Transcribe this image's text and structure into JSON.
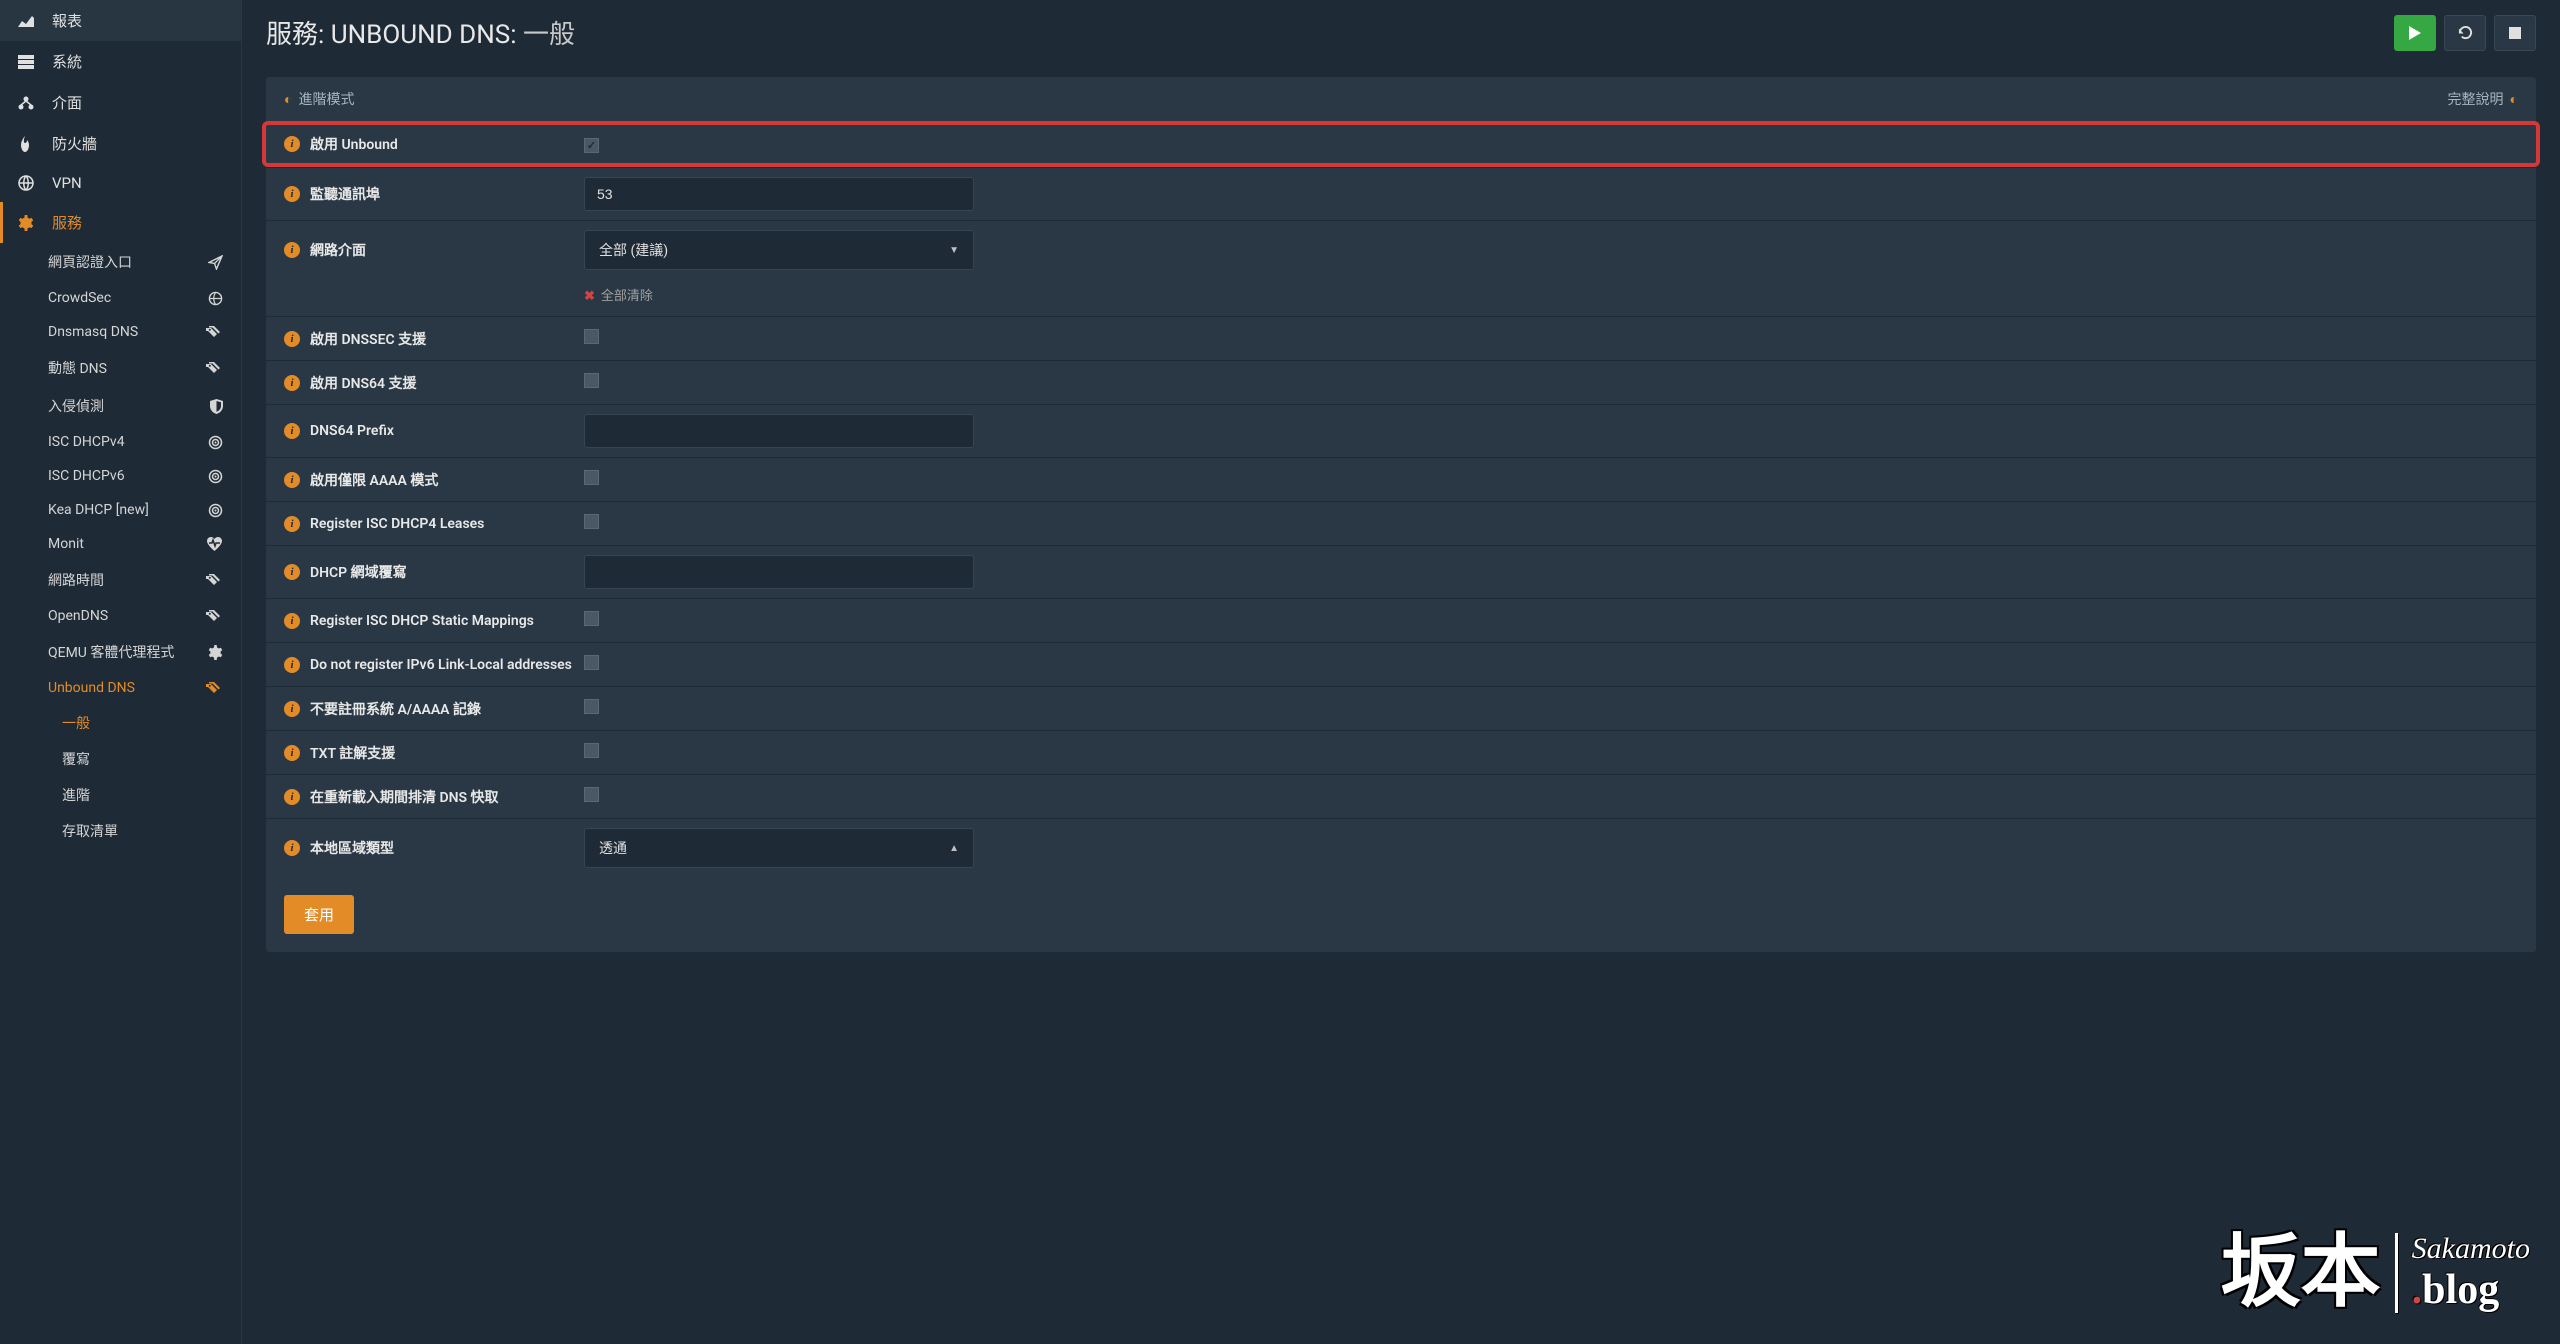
{
  "page": {
    "title_prefix": "服務: UNBOUND DNS:",
    "title_suffix": "一般"
  },
  "sidebar": {
    "top": [
      {
        "label": "報表"
      },
      {
        "label": "系統"
      },
      {
        "label": "介面"
      },
      {
        "label": "防火牆"
      },
      {
        "label": "VPN"
      },
      {
        "label": "服務"
      }
    ],
    "services": [
      {
        "label": "網頁認證入口"
      },
      {
        "label": "CrowdSec"
      },
      {
        "label": "Dnsmasq DNS"
      },
      {
        "label": "動態 DNS"
      },
      {
        "label": "入侵偵測"
      },
      {
        "label": "ISC DHCPv4"
      },
      {
        "label": "ISC DHCPv6"
      },
      {
        "label": "Kea DHCP [new]"
      },
      {
        "label": "Monit"
      },
      {
        "label": "網路時間"
      },
      {
        "label": "OpenDNS"
      },
      {
        "label": "QEMU 客體代理程式"
      },
      {
        "label": "Unbound DNS"
      }
    ],
    "unbound_sub": [
      {
        "label": "一般"
      },
      {
        "label": "覆寫"
      },
      {
        "label": "進階"
      },
      {
        "label": "存取清單"
      }
    ]
  },
  "panel": {
    "advanced_mode": "進階模式",
    "full_help": "完整說明",
    "clear_all": "全部清除",
    "apply": "套用"
  },
  "form": {
    "enable_unbound": {
      "label": "啟用 Unbound"
    },
    "listen_port": {
      "label": "監聽通訊埠",
      "value": "53"
    },
    "network_interface": {
      "label": "網路介面",
      "value": "全部 (建議)"
    },
    "enable_dnssec": {
      "label": "啟用 DNSSEC 支援"
    },
    "enable_dns64": {
      "label": "啟用 DNS64 支援"
    },
    "dns64_prefix": {
      "label": "DNS64 Prefix",
      "value": ""
    },
    "aaaa_only": {
      "label": "啟用僅限 AAAA 模式"
    },
    "register_dhcp4": {
      "label": "Register ISC DHCP4 Leases"
    },
    "dhcp_domain": {
      "label": "DHCP 網域覆寫",
      "value": ""
    },
    "register_static": {
      "label": "Register ISC DHCP Static Mappings"
    },
    "no_ipv6_ll": {
      "label": "Do not register IPv6 Link-Local addresses"
    },
    "no_a_aaaa": {
      "label": "不要註冊系統 A/AAAA 記錄"
    },
    "txt_support": {
      "label": "TXT 註解支援"
    },
    "flush_cache": {
      "label": "在重新載入期間排清 DNS 快取"
    },
    "local_zone_type": {
      "label": "本地區域類型",
      "value": "透通"
    }
  },
  "watermark": {
    "kanji": "坂本",
    "top": "Sakamoto",
    "bot_prefix": ".",
    "bot": "blog"
  }
}
